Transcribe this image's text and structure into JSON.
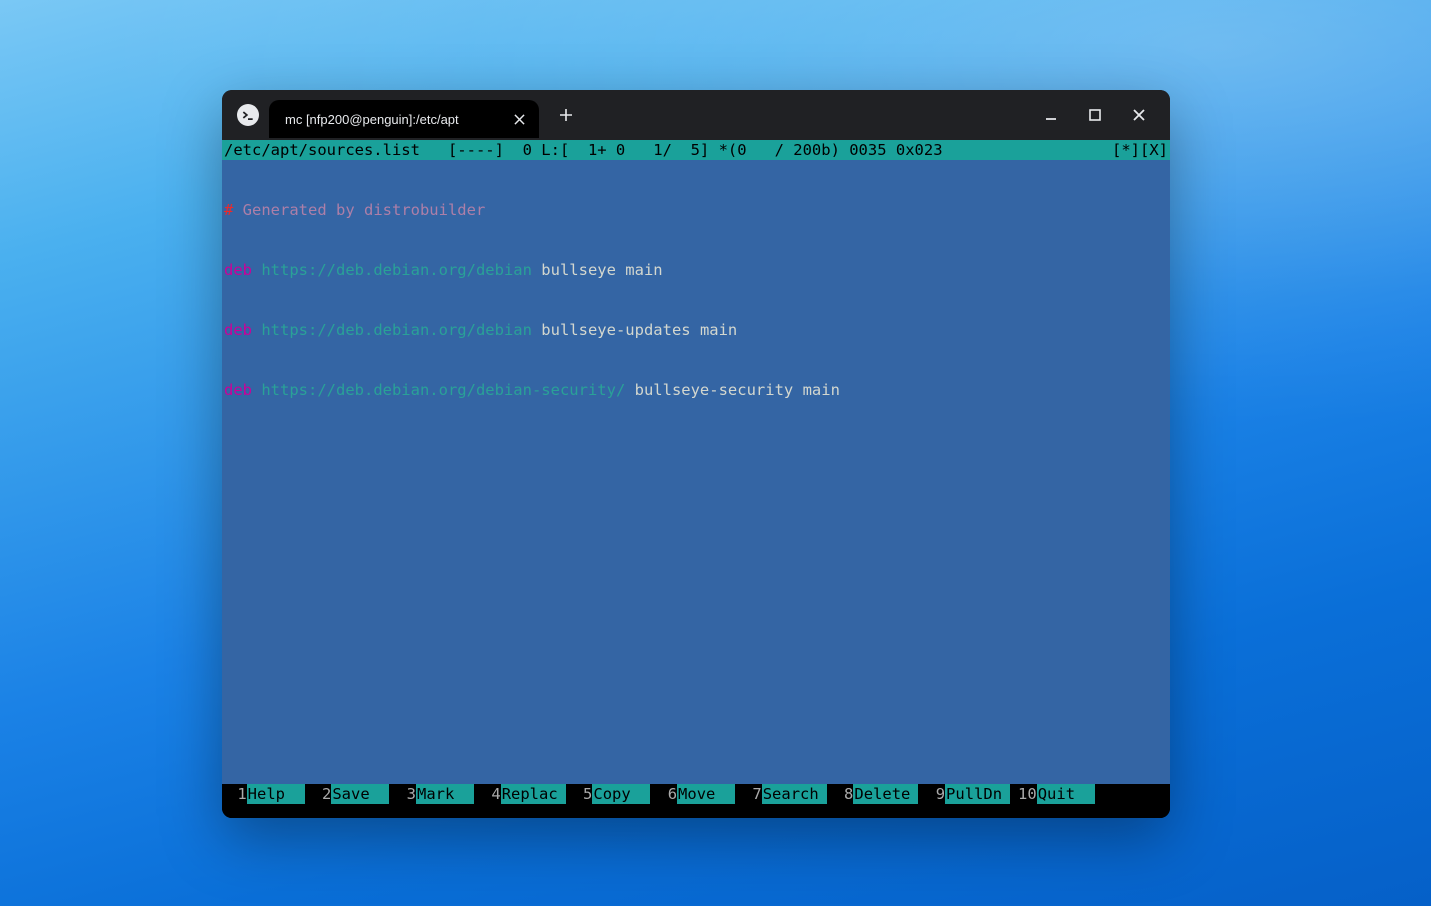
{
  "window": {
    "tab_title": "mc [nfp200@penguin]:/etc/apt",
    "status_left": "/etc/apt/sources.list   [----]  0 L:[  1+ 0   1/  5] *(0   / 200b) 0035 0x023",
    "status_right": "[*][X]"
  },
  "editor": {
    "lines": [
      {
        "hash": "#",
        "comment": " Generated by distrobuilder"
      },
      {
        "deb": "deb",
        "url": " https://deb.debian.org/debian",
        "rest": " bullseye main"
      },
      {
        "deb": "deb",
        "url": " https://deb.debian.org/debian",
        "rest": " bullseye-updates main"
      },
      {
        "deb": "deb",
        "url": " https://deb.debian.org/debian-security/",
        "rest": " bullseye-security main"
      }
    ]
  },
  "fkeys": [
    {
      "n": " 1",
      "label": "Help"
    },
    {
      "n": " 2",
      "label": "Save"
    },
    {
      "n": " 3",
      "label": "Mark"
    },
    {
      "n": " 4",
      "label": "Replac"
    },
    {
      "n": " 5",
      "label": "Copy"
    },
    {
      "n": " 6",
      "label": "Move"
    },
    {
      "n": " 7",
      "label": "Search"
    },
    {
      "n": " 8",
      "label": "Delete"
    },
    {
      "n": " 9",
      "label": "PullDn"
    },
    {
      "n": "10",
      "label": "Quit"
    }
  ]
}
